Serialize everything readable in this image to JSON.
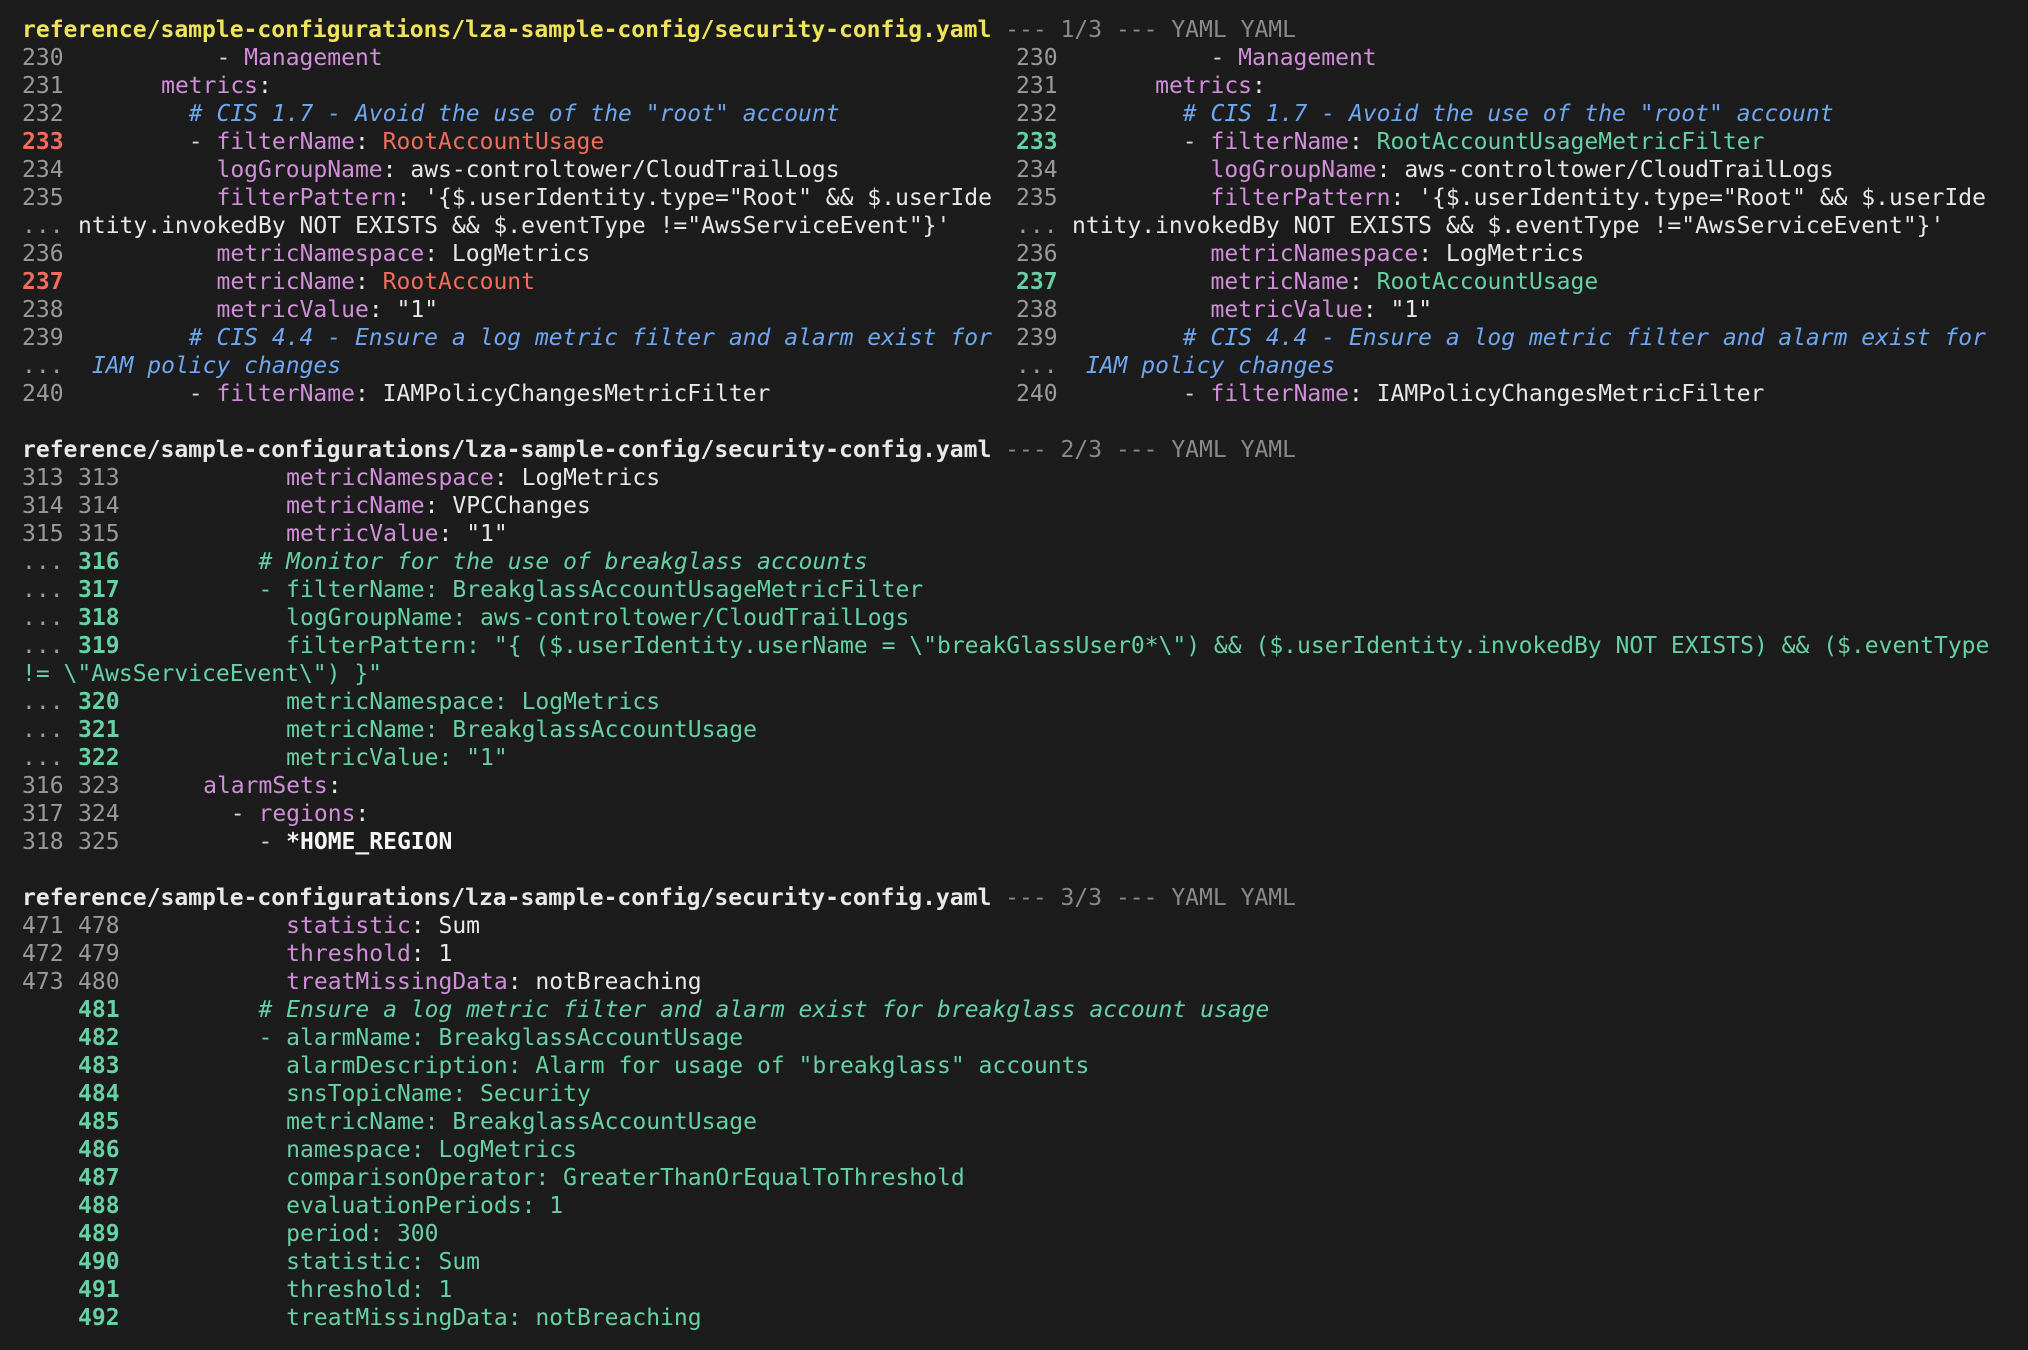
{
  "file_path": "reference/sample-configurations/lza-sample-config/security-config.yaml",
  "language": "YAML",
  "hunks": [
    {
      "label": "--- 1/3 --- YAML",
      "layout": "split",
      "rows": [
        {
          "l": {
            "n": "230",
            "type": "ctx",
            "segs": [
              [
                "ws",
                "          - "
              ],
              [
                "key",
                "Management"
              ]
            ]
          },
          "r": {
            "n": "230",
            "type": "ctx",
            "segs": [
              [
                "ws",
                "          - "
              ],
              [
                "key",
                "Management"
              ]
            ]
          }
        },
        {
          "l": {
            "n": "231",
            "type": "ctx",
            "segs": [
              [
                "ws",
                "      "
              ],
              [
                "key",
                "metrics"
              ],
              [
                "val",
                ":"
              ]
            ]
          },
          "r": {
            "n": "231",
            "type": "ctx",
            "segs": [
              [
                "ws",
                "      "
              ],
              [
                "key",
                "metrics"
              ],
              [
                "val",
                ":"
              ]
            ]
          }
        },
        {
          "l": {
            "n": "232",
            "type": "ctx",
            "segs": [
              [
                "ws",
                "        "
              ],
              [
                "cmt",
                "# CIS 1.7 - Avoid the use of the \"root\" account"
              ]
            ]
          },
          "r": {
            "n": "232",
            "type": "ctx",
            "segs": [
              [
                "ws",
                "        "
              ],
              [
                "cmt",
                "# CIS 1.7 - Avoid the use of the \"root\" account"
              ]
            ]
          }
        },
        {
          "l": {
            "n": "233",
            "type": "del",
            "segs": [
              [
                "ws",
                "        - "
              ],
              [
                "key",
                "filterName"
              ],
              [
                "val",
                ": "
              ],
              [
                "del",
                "RootAccountUsage"
              ]
            ]
          },
          "r": {
            "n": "233",
            "type": "add",
            "segs": [
              [
                "ws",
                "        - "
              ],
              [
                "key",
                "filterName"
              ],
              [
                "val",
                ": "
              ],
              [
                "add",
                "RootAccountUsageMetricFilter"
              ]
            ]
          }
        },
        {
          "l": {
            "n": "234",
            "type": "ctx",
            "segs": [
              [
                "ws",
                "          "
              ],
              [
                "key",
                "logGroupName"
              ],
              [
                "val",
                ": aws-controltower/CloudTrailLogs"
              ]
            ]
          },
          "r": {
            "n": "234",
            "type": "ctx",
            "segs": [
              [
                "ws",
                "          "
              ],
              [
                "key",
                "logGroupName"
              ],
              [
                "val",
                ": aws-controltower/CloudTrailLogs"
              ]
            ]
          }
        },
        {
          "l": {
            "n": "235",
            "type": "ctx",
            "segs": [
              [
                "ws",
                "          "
              ],
              [
                "key",
                "filterPattern"
              ],
              [
                "val",
                ": '{$.userIdentity.type=\"Root\" && $.userIde"
              ]
            ]
          },
          "r": {
            "n": "235",
            "type": "ctx",
            "segs": [
              [
                "ws",
                "          "
              ],
              [
                "key",
                "filterPattern"
              ],
              [
                "val",
                ": '{$.userIdentity.type=\"Root\" && $.userIde"
              ]
            ]
          }
        },
        {
          "l": {
            "n": "...",
            "type": "ctx",
            "segs": [
              [
                "val",
                "ntity.invokedBy NOT EXISTS && $.eventType !=\"AwsServiceEvent\"}'"
              ]
            ]
          },
          "r": {
            "n": "...",
            "type": "ctx",
            "segs": [
              [
                "val",
                "ntity.invokedBy NOT EXISTS && $.eventType !=\"AwsServiceEvent\"}'"
              ]
            ]
          }
        },
        {
          "l": {
            "n": "236",
            "type": "ctx",
            "segs": [
              [
                "ws",
                "          "
              ],
              [
                "key",
                "metricNamespace"
              ],
              [
                "val",
                ": LogMetrics"
              ]
            ]
          },
          "r": {
            "n": "236",
            "type": "ctx",
            "segs": [
              [
                "ws",
                "          "
              ],
              [
                "key",
                "metricNamespace"
              ],
              [
                "val",
                ": LogMetrics"
              ]
            ]
          }
        },
        {
          "l": {
            "n": "237",
            "type": "del",
            "segs": [
              [
                "ws",
                "          "
              ],
              [
                "key",
                "metricName"
              ],
              [
                "val",
                ": "
              ],
              [
                "del",
                "RootAccount"
              ]
            ]
          },
          "r": {
            "n": "237",
            "type": "add",
            "segs": [
              [
                "ws",
                "          "
              ],
              [
                "key",
                "metricName"
              ],
              [
                "val",
                ": "
              ],
              [
                "add",
                "RootAccountUsage"
              ]
            ]
          }
        },
        {
          "l": {
            "n": "238",
            "type": "ctx",
            "segs": [
              [
                "ws",
                "          "
              ],
              [
                "key",
                "metricValue"
              ],
              [
                "val",
                ": \"1\""
              ]
            ]
          },
          "r": {
            "n": "238",
            "type": "ctx",
            "segs": [
              [
                "ws",
                "          "
              ],
              [
                "key",
                "metricValue"
              ],
              [
                "val",
                ": \"1\""
              ]
            ]
          }
        },
        {
          "l": {
            "n": "239",
            "type": "ctx",
            "segs": [
              [
                "ws",
                "        "
              ],
              [
                "cmt",
                "# CIS 4.4 - Ensure a log metric filter and alarm exist for"
              ]
            ]
          },
          "r": {
            "n": "239",
            "type": "ctx",
            "segs": [
              [
                "ws",
                "        "
              ],
              [
                "cmt",
                "# CIS 4.4 - Ensure a log metric filter and alarm exist for"
              ]
            ]
          }
        },
        {
          "l": {
            "n": "...",
            "type": "ctx",
            "segs": [
              [
                "ws",
                " "
              ],
              [
                "cmt",
                "IAM policy changes"
              ]
            ]
          },
          "r": {
            "n": "...",
            "type": "ctx",
            "segs": [
              [
                "ws",
                " "
              ],
              [
                "cmt",
                "IAM policy changes"
              ]
            ]
          }
        },
        {
          "l": {
            "n": "240",
            "type": "ctx",
            "segs": [
              [
                "ws",
                "        - "
              ],
              [
                "key",
                "filterName"
              ],
              [
                "val",
                ": IAMPolicyChangesMetricFilter"
              ]
            ]
          },
          "r": {
            "n": "240",
            "type": "ctx",
            "segs": [
              [
                "ws",
                "        - "
              ],
              [
                "key",
                "filterName"
              ],
              [
                "val",
                ": IAMPolicyChangesMetricFilter"
              ]
            ]
          }
        }
      ]
    },
    {
      "label": "--- 2/3 --- YAML",
      "layout": "unified",
      "rows": [
        {
          "o": "313",
          "n": "313",
          "type": "ctx",
          "segs": [
            [
              "ws",
              "            "
            ],
            [
              "key",
              "metricNamespace"
            ],
            [
              "val",
              ": LogMetrics"
            ]
          ]
        },
        {
          "o": "314",
          "n": "314",
          "type": "ctx",
          "segs": [
            [
              "ws",
              "            "
            ],
            [
              "key",
              "metricName"
            ],
            [
              "val",
              ": VPCChanges"
            ]
          ]
        },
        {
          "o": "315",
          "n": "315",
          "type": "ctx",
          "segs": [
            [
              "ws",
              "            "
            ],
            [
              "key",
              "metricValue"
            ],
            [
              "val",
              ": \"1\""
            ]
          ]
        },
        {
          "o": "...",
          "n": "316",
          "type": "add",
          "segs": [
            [
              "ws",
              "          "
            ],
            [
              "cmtadd",
              "# Monitor for the use of breakglass accounts"
            ]
          ]
        },
        {
          "o": "...",
          "n": "317",
          "type": "add",
          "segs": [
            [
              "ws",
              "          "
            ],
            [
              "add",
              "- filterName: BreakglassAccountUsageMetricFilter"
            ]
          ]
        },
        {
          "o": "...",
          "n": "318",
          "type": "add",
          "segs": [
            [
              "ws",
              "            "
            ],
            [
              "add",
              "logGroupName: aws-controltower/CloudTrailLogs"
            ]
          ]
        },
        {
          "o": "...",
          "n": "319",
          "type": "add",
          "segs": [
            [
              "ws",
              "            "
            ],
            [
              "add",
              "filterPattern: \"{ ($.userIdentity.userName = \\\"breakGlassUser0*\\\") && ($.userIdentity.invokedBy NOT EXISTS) && ($.eventType"
            ]
          ]
        },
        {
          "o": "",
          "n": "",
          "type": "wrap",
          "segs": [
            [
              "add",
              "!= \\\"AwsServiceEvent\\\") }\""
            ]
          ]
        },
        {
          "o": "...",
          "n": "320",
          "type": "add",
          "segs": [
            [
              "ws",
              "            "
            ],
            [
              "add",
              "metricNamespace: LogMetrics"
            ]
          ]
        },
        {
          "o": "...",
          "n": "321",
          "type": "add",
          "segs": [
            [
              "ws",
              "            "
            ],
            [
              "add",
              "metricName: BreakglassAccountUsage"
            ]
          ]
        },
        {
          "o": "...",
          "n": "322",
          "type": "add",
          "segs": [
            [
              "ws",
              "            "
            ],
            [
              "add",
              "metricValue: \"1\""
            ]
          ]
        },
        {
          "o": "316",
          "n": "323",
          "type": "ctx",
          "segs": [
            [
              "ws",
              "      "
            ],
            [
              "key",
              "alarmSets"
            ],
            [
              "val",
              ":"
            ]
          ]
        },
        {
          "o": "317",
          "n": "324",
          "type": "ctx",
          "segs": [
            [
              "ws",
              "        - "
            ],
            [
              "key",
              "regions"
            ],
            [
              "val",
              ":"
            ]
          ]
        },
        {
          "o": "318",
          "n": "325",
          "type": "ctx",
          "segs": [
            [
              "ws",
              "          - "
            ],
            [
              "bold",
              "*HOME_REGION"
            ]
          ]
        }
      ]
    },
    {
      "label": "--- 3/3 --- YAML",
      "layout": "unified",
      "rows": [
        {
          "o": "471",
          "n": "478",
          "type": "ctx",
          "segs": [
            [
              "ws",
              "            "
            ],
            [
              "key",
              "statistic"
            ],
            [
              "val",
              ": Sum"
            ]
          ]
        },
        {
          "o": "472",
          "n": "479",
          "type": "ctx",
          "segs": [
            [
              "ws",
              "            "
            ],
            [
              "key",
              "threshold"
            ],
            [
              "val",
              ": 1"
            ]
          ]
        },
        {
          "o": "473",
          "n": "480",
          "type": "ctx",
          "segs": [
            [
              "ws",
              "            "
            ],
            [
              "key",
              "treatMissingData"
            ],
            [
              "val",
              ": notBreaching"
            ]
          ]
        },
        {
          "o": "",
          "n": "481",
          "type": "add",
          "segs": [
            [
              "ws",
              "          "
            ],
            [
              "cmtadd",
              "# Ensure a log metric filter and alarm exist for breakglass account usage"
            ]
          ]
        },
        {
          "o": "",
          "n": "482",
          "type": "add",
          "segs": [
            [
              "ws",
              "          "
            ],
            [
              "add",
              "- alarmName: BreakglassAccountUsage"
            ]
          ]
        },
        {
          "o": "",
          "n": "483",
          "type": "add",
          "segs": [
            [
              "ws",
              "            "
            ],
            [
              "add",
              "alarmDescription: Alarm for usage of \"breakglass\" accounts"
            ]
          ]
        },
        {
          "o": "",
          "n": "484",
          "type": "add",
          "segs": [
            [
              "ws",
              "            "
            ],
            [
              "add",
              "snsTopicName: Security"
            ]
          ]
        },
        {
          "o": "",
          "n": "485",
          "type": "add",
          "segs": [
            [
              "ws",
              "            "
            ],
            [
              "add",
              "metricName: BreakglassAccountUsage"
            ]
          ]
        },
        {
          "o": "",
          "n": "486",
          "type": "add",
          "segs": [
            [
              "ws",
              "            "
            ],
            [
              "add",
              "namespace: LogMetrics"
            ]
          ]
        },
        {
          "o": "",
          "n": "487",
          "type": "add",
          "segs": [
            [
              "ws",
              "            "
            ],
            [
              "add",
              "comparisonOperator: GreaterThanOrEqualToThreshold"
            ]
          ]
        },
        {
          "o": "",
          "n": "488",
          "type": "add",
          "segs": [
            [
              "ws",
              "            "
            ],
            [
              "add",
              "evaluationPeriods: 1"
            ]
          ]
        },
        {
          "o": "",
          "n": "489",
          "type": "add",
          "segs": [
            [
              "ws",
              "            "
            ],
            [
              "add",
              "period: 300"
            ]
          ]
        },
        {
          "o": "",
          "n": "490",
          "type": "add",
          "segs": [
            [
              "ws",
              "            "
            ],
            [
              "add",
              "statistic: Sum"
            ]
          ]
        },
        {
          "o": "",
          "n": "491",
          "type": "add",
          "segs": [
            [
              "ws",
              "            "
            ],
            [
              "add",
              "threshold: 1"
            ]
          ]
        },
        {
          "o": "",
          "n": "492",
          "type": "add",
          "segs": [
            [
              "ws",
              "            "
            ],
            [
              "add",
              "treatMissingData: notBreaching"
            ]
          ]
        }
      ]
    }
  ]
}
